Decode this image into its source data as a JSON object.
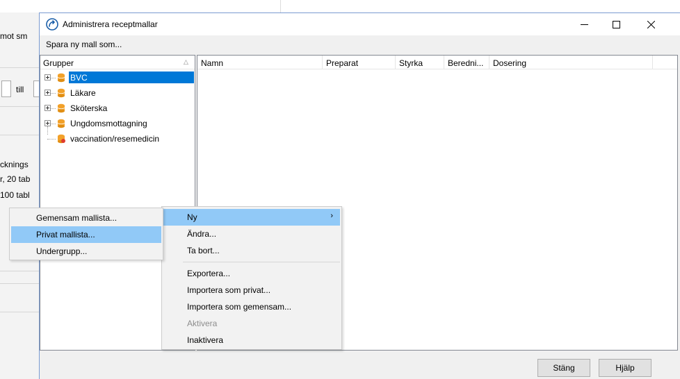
{
  "background": {
    "snippets": [
      "mot sm",
      "till",
      "cknings",
      "r, 20 tab",
      "100 tabl"
    ]
  },
  "dialog": {
    "title": "Administrera receptmallar",
    "toolbar": {
      "save_as_label": "Spara ny mall som..."
    },
    "tree": {
      "header": "Grupper",
      "items": [
        {
          "label": "BVC",
          "selected": true,
          "icon": "database-icon"
        },
        {
          "label": "Läkare",
          "icon": "database-icon"
        },
        {
          "label": "Sköterska",
          "icon": "database-icon"
        },
        {
          "label": "Ungdomsmottagning",
          "icon": "database-icon"
        },
        {
          "label": "vaccination/resemedicin",
          "icon": "database-private-icon"
        }
      ]
    },
    "grid": {
      "columns": [
        "Namn",
        "Preparat",
        "Styrka",
        "Beredni...",
        "Dosering"
      ]
    },
    "footer": {
      "close_label": "Stäng",
      "help_label": "Hjälp"
    }
  },
  "context_menu": {
    "items": [
      {
        "label": "Ny",
        "has_submenu": true,
        "highlighted": true
      },
      {
        "label": "Ändra..."
      },
      {
        "label": "Ta bort..."
      },
      {
        "label": "Exportera..."
      },
      {
        "label": "Importera som privat..."
      },
      {
        "label": "Importera som gemensam..."
      },
      {
        "label": "Aktivera",
        "disabled": true
      },
      {
        "label": "Inaktivera"
      }
    ]
  },
  "submenu": {
    "items": [
      {
        "label": "Gemensam mallista..."
      },
      {
        "label": "Privat mallista...",
        "highlighted": true
      },
      {
        "label": "Undergrupp..."
      }
    ]
  },
  "colors": {
    "selection": "#0078d7",
    "menu_highlight": "#91c9f7",
    "db_icon": "#f2a12a"
  }
}
